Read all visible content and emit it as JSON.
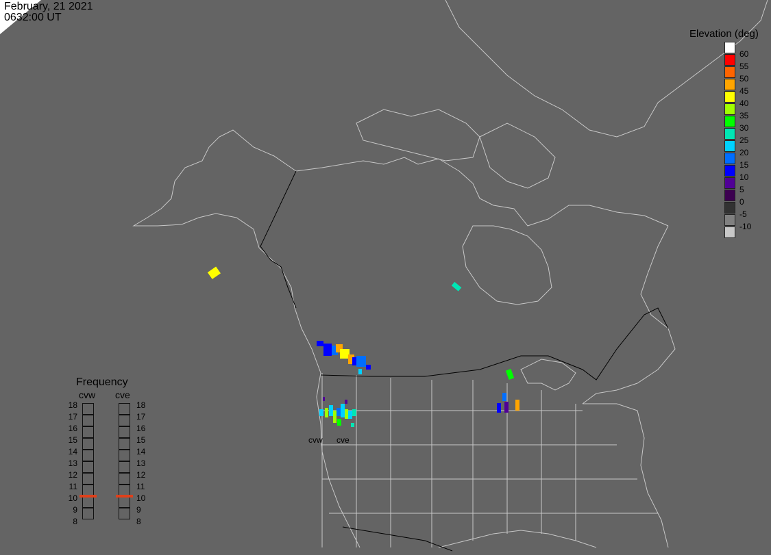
{
  "header": {
    "date": "February, 21 2021",
    "time": "0632:00 UT"
  },
  "legend": {
    "title": "Elevation (deg)",
    "entries": [
      {
        "label": "60",
        "color": "#ffffff"
      },
      {
        "label": "55",
        "color": "#ff0000"
      },
      {
        "label": "50",
        "color": "#ff6400"
      },
      {
        "label": "45",
        "color": "#ffa500"
      },
      {
        "label": "40",
        "color": "#ffff00"
      },
      {
        "label": "35",
        "color": "#a0ff00"
      },
      {
        "label": "30",
        "color": "#00ff00"
      },
      {
        "label": "25",
        "color": "#00e6b4"
      },
      {
        "label": "20",
        "color": "#00d2ff"
      },
      {
        "label": "15",
        "color": "#006eff"
      },
      {
        "label": "10",
        "color": "#0000ff"
      },
      {
        "label": "5",
        "color": "#500096"
      },
      {
        "label": "0",
        "color": "#3c0050"
      },
      {
        "label": "-5",
        "color": "#323232"
      },
      {
        "label": "-10",
        "color": "#808080"
      },
      {
        "label": "",
        "color": "#c8c8c8"
      }
    ]
  },
  "frequency": {
    "title": "Frequency",
    "radars": [
      "cvw",
      "cve"
    ],
    "scale": [
      "18",
      "17",
      "16",
      "15",
      "14",
      "13",
      "12",
      "11",
      "10",
      "9",
      "8"
    ],
    "current": {
      "cvw": 10.5,
      "cve": 10.5
    }
  },
  "map": {
    "radar_labels": [
      "cvw",
      "cve"
    ],
    "colors": {
      "background": "#646464",
      "coastline": "#c8c8c8",
      "border": "#000000",
      "daylight": "#ffffff"
    }
  }
}
